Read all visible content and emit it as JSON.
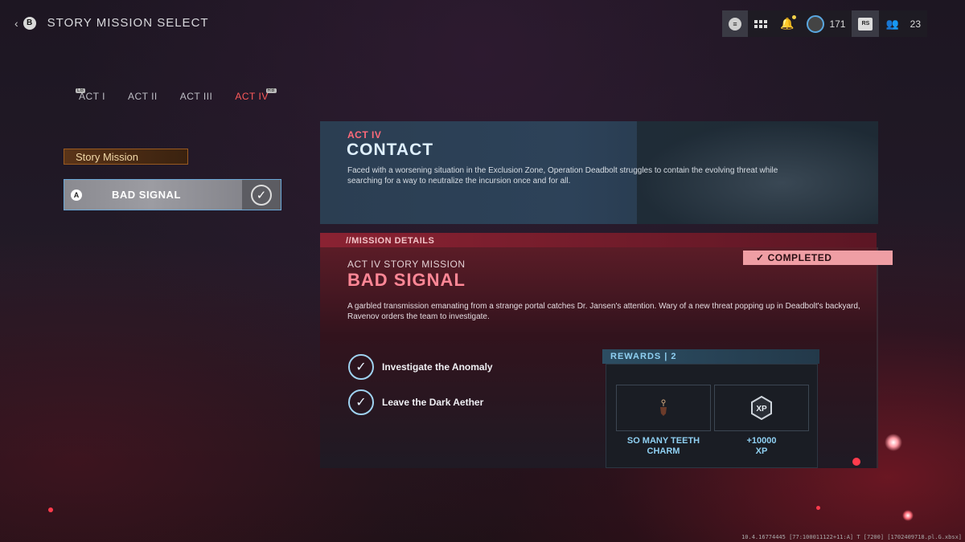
{
  "header": {
    "back_glyph": "B",
    "title": "STORY MISSION SELECT"
  },
  "topbar": {
    "menu_glyph": "≡",
    "level": "171",
    "rs_glyph": "RS",
    "party_count": "23"
  },
  "acts": {
    "items": [
      {
        "label": "ACT I"
      },
      {
        "label": "ACT II"
      },
      {
        "label": "ACT III"
      },
      {
        "label": "ACT IV"
      }
    ],
    "active": 3,
    "lb_glyph": "LB",
    "rb_glyph": "RB"
  },
  "sidebar": {
    "section_label": "Story Mission",
    "mission": {
      "button_glyph": "A",
      "name": "BAD SIGNAL",
      "completed": true
    }
  },
  "act_panel": {
    "subtitle": "ACT IV",
    "title": "CONTACT",
    "description": "Faced with a worsening situation in the Exclusion Zone, Operation Deadbolt struggles to contain the evolving threat while searching for a way to neutralize the incursion once and for all."
  },
  "details": {
    "bar_label": "//MISSION DETAILS",
    "status": "COMPLETED",
    "subtitle": "ACT IV STORY MISSION",
    "title": "BAD SIGNAL",
    "description": "A garbled transmission emanating from a strange portal catches Dr. Jansen's attention. Wary of a new threat popping up in Deadbolt's backyard, Ravenov orders the team to investigate.",
    "objectives": [
      {
        "label": "Investigate the Anomaly",
        "done": true
      },
      {
        "label": "Leave the Dark Aether",
        "done": true
      }
    ]
  },
  "rewards": {
    "header": "REWARDS | 2",
    "items": [
      {
        "icon": "charm-icon",
        "line1": "SO MANY TEETH",
        "line2": "CHARM"
      },
      {
        "icon": "xp-icon",
        "icon_text": "XP",
        "line1": "+10000",
        "line2": "XP"
      }
    ]
  },
  "watermark": "10.4.16774445 [77:100011122+11:A] T [7200] [1702409718.pl.G.xbsx]",
  "colors": {
    "accent_red": "#ff8796",
    "accent_blue": "#8fd0f2",
    "completed_badge": "#ef9ea4",
    "story_label_border": "#9a5a20"
  }
}
